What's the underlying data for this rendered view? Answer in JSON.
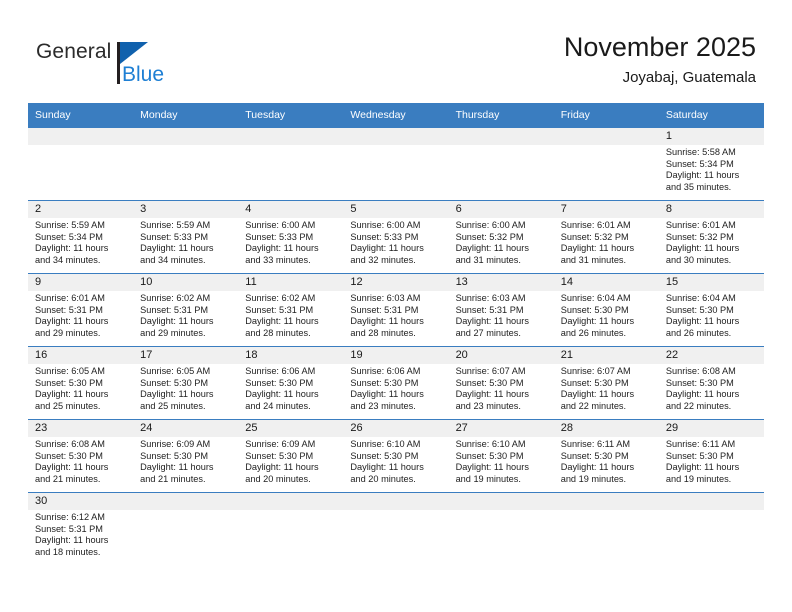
{
  "logo": {
    "word_general": "General",
    "word_blue": "Blue",
    "icon": "flag-triangle-icon",
    "brand_black": "#231f20",
    "brand_blue": "#1e7fd4"
  },
  "header": {
    "month_title": "November 2025",
    "location": "Joyabaj, Guatemala",
    "header_bg": "#3a7dc0",
    "grid_line": "#3a7dc0",
    "daynum_bg": "#f0f0f0"
  },
  "weekday_headers": [
    "Sunday",
    "Monday",
    "Tuesday",
    "Wednesday",
    "Thursday",
    "Friday",
    "Saturday"
  ],
  "weeks": [
    [
      {
        "day": "",
        "blank": true,
        "lines": []
      },
      {
        "day": "",
        "blank": true,
        "lines": []
      },
      {
        "day": "",
        "blank": true,
        "lines": []
      },
      {
        "day": "",
        "blank": true,
        "lines": []
      },
      {
        "day": "",
        "blank": true,
        "lines": []
      },
      {
        "day": "",
        "blank": true,
        "lines": []
      },
      {
        "day": "1",
        "blank": false,
        "lines": [
          "Sunrise: 5:58 AM",
          "Sunset: 5:34 PM",
          "Daylight: 11 hours",
          "and 35 minutes."
        ]
      }
    ],
    [
      {
        "day": "2",
        "blank": false,
        "lines": [
          "Sunrise: 5:59 AM",
          "Sunset: 5:34 PM",
          "Daylight: 11 hours",
          "and 34 minutes."
        ]
      },
      {
        "day": "3",
        "blank": false,
        "lines": [
          "Sunrise: 5:59 AM",
          "Sunset: 5:33 PM",
          "Daylight: 11 hours",
          "and 34 minutes."
        ]
      },
      {
        "day": "4",
        "blank": false,
        "lines": [
          "Sunrise: 6:00 AM",
          "Sunset: 5:33 PM",
          "Daylight: 11 hours",
          "and 33 minutes."
        ]
      },
      {
        "day": "5",
        "blank": false,
        "lines": [
          "Sunrise: 6:00 AM",
          "Sunset: 5:33 PM",
          "Daylight: 11 hours",
          "and 32 minutes."
        ]
      },
      {
        "day": "6",
        "blank": false,
        "lines": [
          "Sunrise: 6:00 AM",
          "Sunset: 5:32 PM",
          "Daylight: 11 hours",
          "and 31 minutes."
        ]
      },
      {
        "day": "7",
        "blank": false,
        "lines": [
          "Sunrise: 6:01 AM",
          "Sunset: 5:32 PM",
          "Daylight: 11 hours",
          "and 31 minutes."
        ]
      },
      {
        "day": "8",
        "blank": false,
        "lines": [
          "Sunrise: 6:01 AM",
          "Sunset: 5:32 PM",
          "Daylight: 11 hours",
          "and 30 minutes."
        ]
      }
    ],
    [
      {
        "day": "9",
        "blank": false,
        "lines": [
          "Sunrise: 6:01 AM",
          "Sunset: 5:31 PM",
          "Daylight: 11 hours",
          "and 29 minutes."
        ]
      },
      {
        "day": "10",
        "blank": false,
        "lines": [
          "Sunrise: 6:02 AM",
          "Sunset: 5:31 PM",
          "Daylight: 11 hours",
          "and 29 minutes."
        ]
      },
      {
        "day": "11",
        "blank": false,
        "lines": [
          "Sunrise: 6:02 AM",
          "Sunset: 5:31 PM",
          "Daylight: 11 hours",
          "and 28 minutes."
        ]
      },
      {
        "day": "12",
        "blank": false,
        "lines": [
          "Sunrise: 6:03 AM",
          "Sunset: 5:31 PM",
          "Daylight: 11 hours",
          "and 28 minutes."
        ]
      },
      {
        "day": "13",
        "blank": false,
        "lines": [
          "Sunrise: 6:03 AM",
          "Sunset: 5:31 PM",
          "Daylight: 11 hours",
          "and 27 minutes."
        ]
      },
      {
        "day": "14",
        "blank": false,
        "lines": [
          "Sunrise: 6:04 AM",
          "Sunset: 5:30 PM",
          "Daylight: 11 hours",
          "and 26 minutes."
        ]
      },
      {
        "day": "15",
        "blank": false,
        "lines": [
          "Sunrise: 6:04 AM",
          "Sunset: 5:30 PM",
          "Daylight: 11 hours",
          "and 26 minutes."
        ]
      }
    ],
    [
      {
        "day": "16",
        "blank": false,
        "lines": [
          "Sunrise: 6:05 AM",
          "Sunset: 5:30 PM",
          "Daylight: 11 hours",
          "and 25 minutes."
        ]
      },
      {
        "day": "17",
        "blank": false,
        "lines": [
          "Sunrise: 6:05 AM",
          "Sunset: 5:30 PM",
          "Daylight: 11 hours",
          "and 25 minutes."
        ]
      },
      {
        "day": "18",
        "blank": false,
        "lines": [
          "Sunrise: 6:06 AM",
          "Sunset: 5:30 PM",
          "Daylight: 11 hours",
          "and 24 minutes."
        ]
      },
      {
        "day": "19",
        "blank": false,
        "lines": [
          "Sunrise: 6:06 AM",
          "Sunset: 5:30 PM",
          "Daylight: 11 hours",
          "and 23 minutes."
        ]
      },
      {
        "day": "20",
        "blank": false,
        "lines": [
          "Sunrise: 6:07 AM",
          "Sunset: 5:30 PM",
          "Daylight: 11 hours",
          "and 23 minutes."
        ]
      },
      {
        "day": "21",
        "blank": false,
        "lines": [
          "Sunrise: 6:07 AM",
          "Sunset: 5:30 PM",
          "Daylight: 11 hours",
          "and 22 minutes."
        ]
      },
      {
        "day": "22",
        "blank": false,
        "lines": [
          "Sunrise: 6:08 AM",
          "Sunset: 5:30 PM",
          "Daylight: 11 hours",
          "and 22 minutes."
        ]
      }
    ],
    [
      {
        "day": "23",
        "blank": false,
        "lines": [
          "Sunrise: 6:08 AM",
          "Sunset: 5:30 PM",
          "Daylight: 11 hours",
          "and 21 minutes."
        ]
      },
      {
        "day": "24",
        "blank": false,
        "lines": [
          "Sunrise: 6:09 AM",
          "Sunset: 5:30 PM",
          "Daylight: 11 hours",
          "and 21 minutes."
        ]
      },
      {
        "day": "25",
        "blank": false,
        "lines": [
          "Sunrise: 6:09 AM",
          "Sunset: 5:30 PM",
          "Daylight: 11 hours",
          "and 20 minutes."
        ]
      },
      {
        "day": "26",
        "blank": false,
        "lines": [
          "Sunrise: 6:10 AM",
          "Sunset: 5:30 PM",
          "Daylight: 11 hours",
          "and 20 minutes."
        ]
      },
      {
        "day": "27",
        "blank": false,
        "lines": [
          "Sunrise: 6:10 AM",
          "Sunset: 5:30 PM",
          "Daylight: 11 hours",
          "and 19 minutes."
        ]
      },
      {
        "day": "28",
        "blank": false,
        "lines": [
          "Sunrise: 6:11 AM",
          "Sunset: 5:30 PM",
          "Daylight: 11 hours",
          "and 19 minutes."
        ]
      },
      {
        "day": "29",
        "blank": false,
        "lines": [
          "Sunrise: 6:11 AM",
          "Sunset: 5:30 PM",
          "Daylight: 11 hours",
          "and 19 minutes."
        ]
      }
    ],
    [
      {
        "day": "30",
        "blank": false,
        "lines": [
          "Sunrise: 6:12 AM",
          "Sunset: 5:31 PM",
          "Daylight: 11 hours",
          "and 18 minutes."
        ]
      },
      {
        "day": "",
        "blank": true,
        "lines": []
      },
      {
        "day": "",
        "blank": true,
        "lines": []
      },
      {
        "day": "",
        "blank": true,
        "lines": []
      },
      {
        "day": "",
        "blank": true,
        "lines": []
      },
      {
        "day": "",
        "blank": true,
        "lines": []
      },
      {
        "day": "",
        "blank": true,
        "lines": []
      }
    ]
  ]
}
